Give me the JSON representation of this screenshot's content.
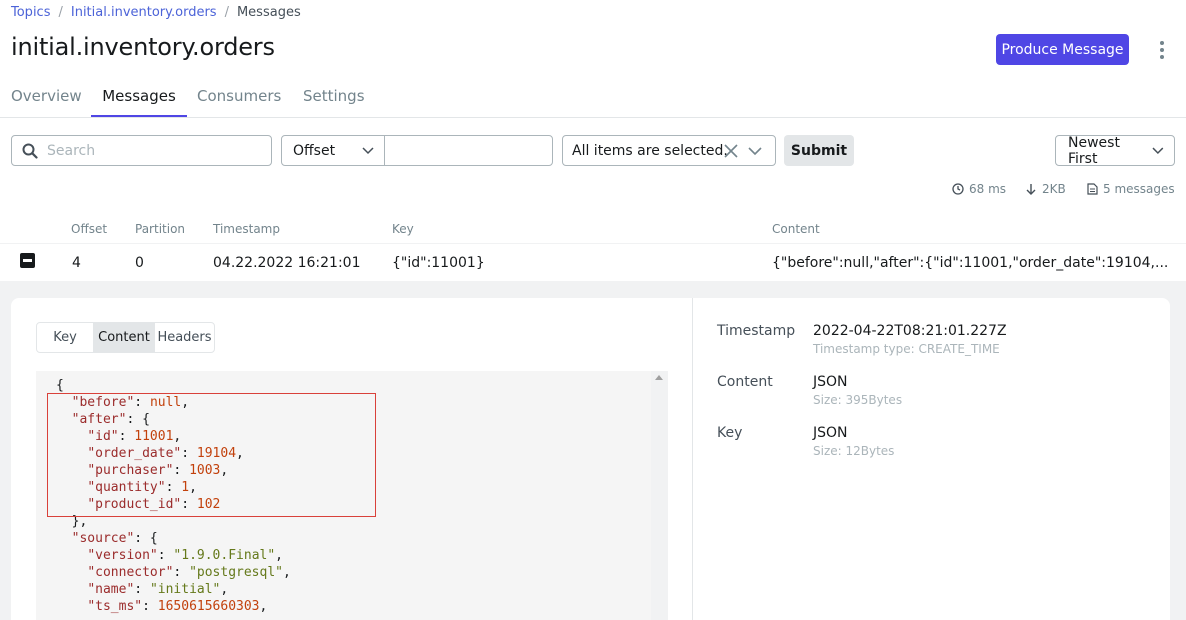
{
  "breadcrumb": {
    "topics": "Topics",
    "topic": "Initial.inventory.orders",
    "current": "Messages",
    "sep": "/"
  },
  "page_title": "initial.inventory.orders",
  "actions": {
    "produce_label": "Produce Message"
  },
  "tabs": [
    "Overview",
    "Messages",
    "Consumers",
    "Settings"
  ],
  "active_tab": "Messages",
  "filters": {
    "search_placeholder": "Search",
    "seek_type": "Offset",
    "seek_value": "",
    "partitions": "All items are selected.",
    "submit_label": "Submit",
    "sort": "Newest First"
  },
  "stats": {
    "time": "68 ms",
    "size": "2KB",
    "messages": "5 messages"
  },
  "table": {
    "headers": [
      "Offset",
      "Partition",
      "Timestamp",
      "Key",
      "Content"
    ],
    "row": {
      "offset": "4",
      "partition": "0",
      "timestamp": "04.22.2022 16:21:01",
      "key": "{\"id\":11001}",
      "content": "{\"before\":null,\"after\":{\"id\":11001,\"order_date\":19104,..."
    }
  },
  "detail": {
    "subtabs": [
      "Key",
      "Content",
      "Headers"
    ],
    "active_subtab": "Content",
    "code_lines": [
      [
        {
          "t": "p",
          "v": "{"
        }
      ],
      [
        {
          "t": "p",
          "v": "  "
        },
        {
          "t": "k",
          "v": "\"before\""
        },
        {
          "t": "p",
          "v": ": "
        },
        {
          "t": "n",
          "v": "null"
        },
        {
          "t": "p",
          "v": ","
        }
      ],
      [
        {
          "t": "p",
          "v": "  "
        },
        {
          "t": "k",
          "v": "\"after\""
        },
        {
          "t": "p",
          "v": ": {"
        }
      ],
      [
        {
          "t": "p",
          "v": "    "
        },
        {
          "t": "k",
          "v": "\"id\""
        },
        {
          "t": "p",
          "v": ": "
        },
        {
          "t": "n",
          "v": "11001"
        },
        {
          "t": "p",
          "v": ","
        }
      ],
      [
        {
          "t": "p",
          "v": "    "
        },
        {
          "t": "k",
          "v": "\"order_date\""
        },
        {
          "t": "p",
          "v": ": "
        },
        {
          "t": "n",
          "v": "19104"
        },
        {
          "t": "p",
          "v": ","
        }
      ],
      [
        {
          "t": "p",
          "v": "    "
        },
        {
          "t": "k",
          "v": "\"purchaser\""
        },
        {
          "t": "p",
          "v": ": "
        },
        {
          "t": "n",
          "v": "1003"
        },
        {
          "t": "p",
          "v": ","
        }
      ],
      [
        {
          "t": "p",
          "v": "    "
        },
        {
          "t": "k",
          "v": "\"quantity\""
        },
        {
          "t": "p",
          "v": ": "
        },
        {
          "t": "n",
          "v": "1"
        },
        {
          "t": "p",
          "v": ","
        }
      ],
      [
        {
          "t": "p",
          "v": "    "
        },
        {
          "t": "k",
          "v": "\"product_id\""
        },
        {
          "t": "p",
          "v": ": "
        },
        {
          "t": "n",
          "v": "102"
        }
      ],
      [
        {
          "t": "p",
          "v": "  },"
        }
      ],
      [
        {
          "t": "p",
          "v": "  "
        },
        {
          "t": "k",
          "v": "\"source\""
        },
        {
          "t": "p",
          "v": ": {"
        }
      ],
      [
        {
          "t": "p",
          "v": "    "
        },
        {
          "t": "k",
          "v": "\"version\""
        },
        {
          "t": "p",
          "v": ": "
        },
        {
          "t": "s",
          "v": "\"1.9.0.Final\""
        },
        {
          "t": "p",
          "v": ","
        }
      ],
      [
        {
          "t": "p",
          "v": "    "
        },
        {
          "t": "k",
          "v": "\"connector\""
        },
        {
          "t": "p",
          "v": ": "
        },
        {
          "t": "s",
          "v": "\"postgresql\""
        },
        {
          "t": "p",
          "v": ","
        }
      ],
      [
        {
          "t": "p",
          "v": "    "
        },
        {
          "t": "k",
          "v": "\"name\""
        },
        {
          "t": "p",
          "v": ": "
        },
        {
          "t": "s",
          "v": "\"initial\""
        },
        {
          "t": "p",
          "v": ","
        }
      ],
      [
        {
          "t": "p",
          "v": "    "
        },
        {
          "t": "k",
          "v": "\"ts_ms\""
        },
        {
          "t": "p",
          "v": ": "
        },
        {
          "t": "n",
          "v": "1650615660303"
        },
        {
          "t": "p",
          "v": ","
        }
      ]
    ],
    "meta": {
      "timestamp_label": "Timestamp",
      "timestamp_value": "2022-04-22T08:21:01.227Z",
      "timestamp_type": "Timestamp type: CREATE_TIME",
      "content_label": "Content",
      "content_value": "JSON",
      "content_size": "Size: 395Bytes",
      "key_label": "Key",
      "key_value": "JSON",
      "key_size": "Size: 12Bytes"
    }
  },
  "colors": {
    "accent": "#4f46e5",
    "highlight_box": "#d9413a"
  }
}
